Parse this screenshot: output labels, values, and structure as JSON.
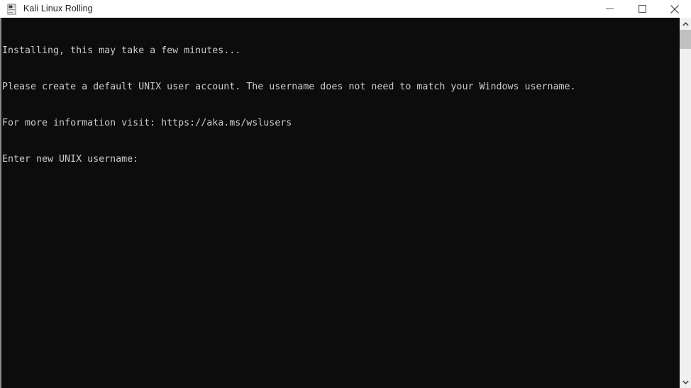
{
  "window": {
    "title": "Kali Linux Rolling",
    "icon": "console-document-icon",
    "controls": {
      "minimize_label": "Minimize",
      "maximize_label": "Maximize",
      "close_label": "Close"
    }
  },
  "console": {
    "background_color": "#0c0c0c",
    "foreground_color": "#cccccc",
    "lines": [
      "Installing, this may take a few minutes...",
      "Please create a default UNIX user account. The username does not need to match your Windows username.",
      "For more information visit: https://aka.ms/wslusers",
      "Enter new UNIX username:"
    ],
    "prompt": "Enter new UNIX username:",
    "url": "https://aka.ms/wslusers"
  },
  "scrollbar": {
    "up_arrow": "chevron-up-icon",
    "down_arrow": "chevron-down-icon",
    "thumb_color": "#c1c1c1",
    "track_color": "#f0f0f0"
  }
}
